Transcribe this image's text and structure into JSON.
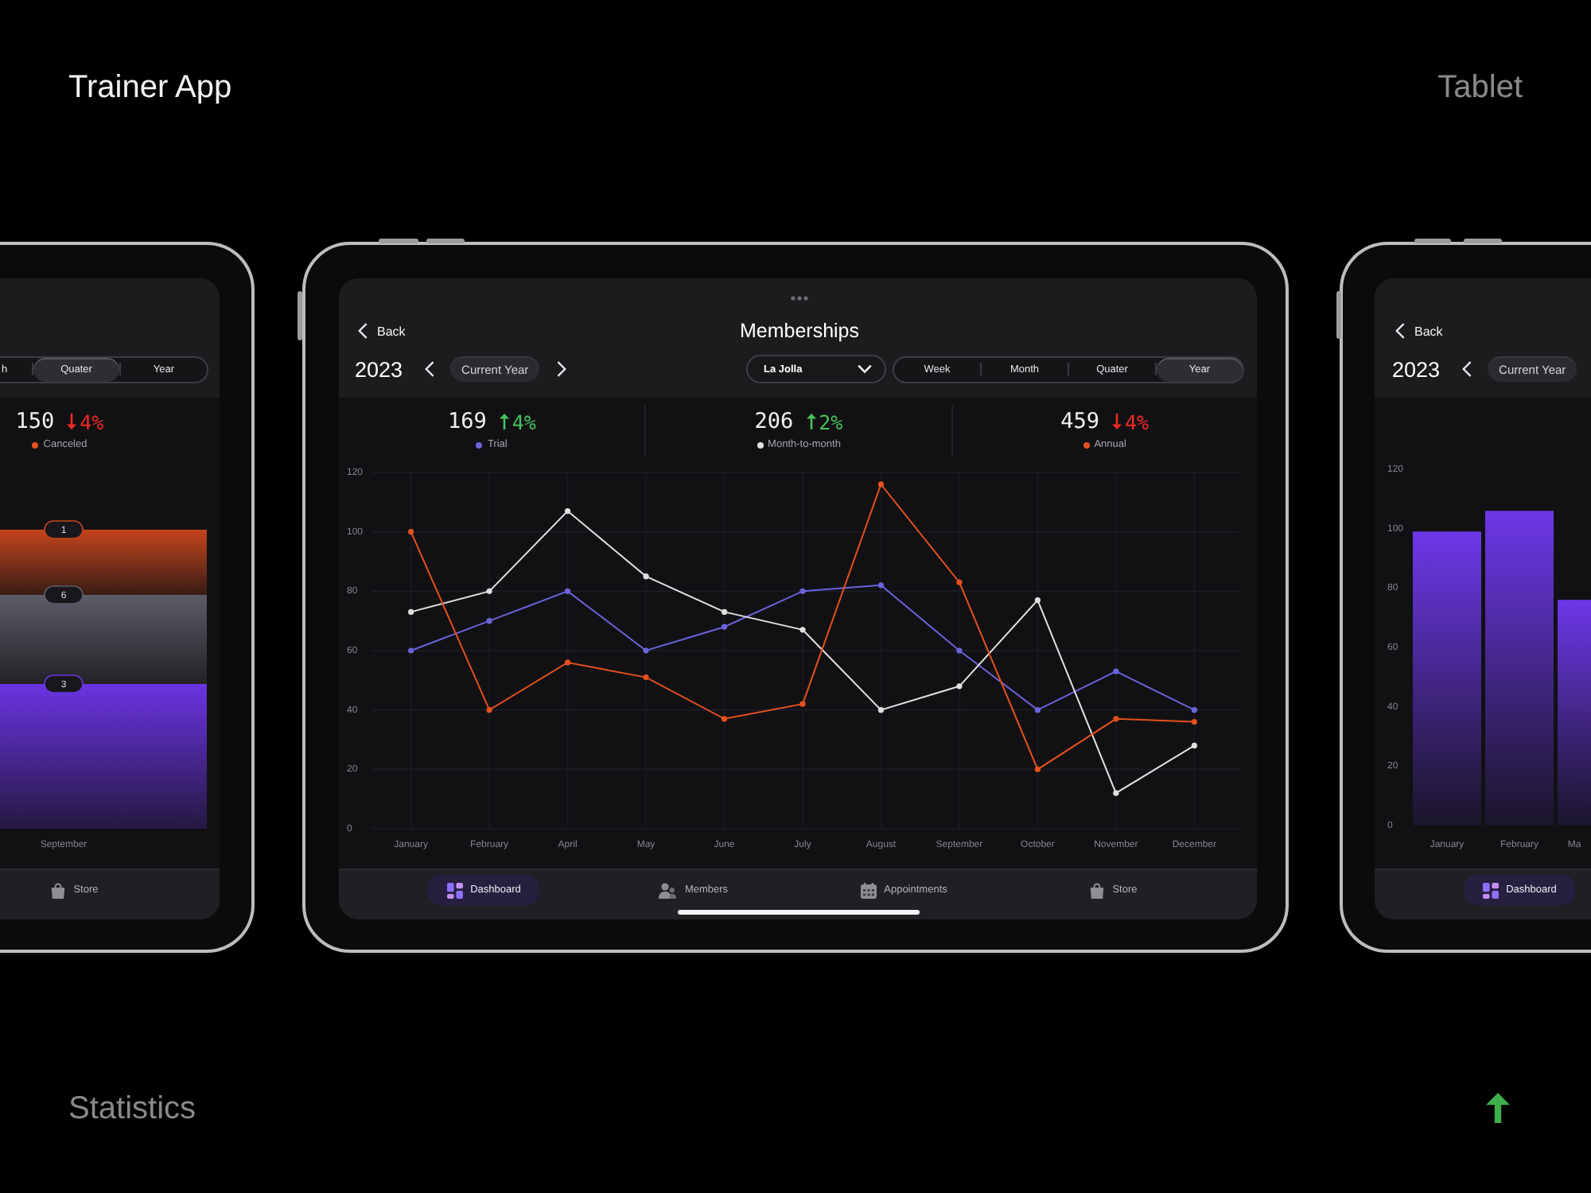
{
  "header": {
    "title": "Trainer App",
    "device": "Tablet"
  },
  "left_tablet": {
    "period_tabs": [
      {
        "label": "h",
        "selected": false
      },
      {
        "label": "Quater",
        "selected": true
      },
      {
        "label": "Year",
        "selected": false
      }
    ],
    "stats": [
      {
        "value": "150",
        "rising": false,
        "change": "4%",
        "label": "Canceled",
        "color": "#e5501e"
      }
    ],
    "stacked_bar": {
      "segments": [
        {
          "label": "1",
          "color": "#c4441b"
        },
        {
          "label": "6",
          "color": "#5c5c68"
        },
        {
          "label": "3",
          "color": "#6a34e2"
        }
      ],
      "category": "September"
    },
    "tab_bar": [
      {
        "kind": "store",
        "label": "Store",
        "selected": false
      }
    ]
  },
  "center_tablet": {
    "back": "Back",
    "title": "Memberships",
    "year": "2023",
    "period": "Current Year",
    "location": "La Jolla",
    "period_tabs": [
      {
        "label": "Week",
        "selected": false
      },
      {
        "label": "Month",
        "selected": false
      },
      {
        "label": "Quater",
        "selected": false
      },
      {
        "label": "Year",
        "selected": true
      }
    ],
    "stats": [
      {
        "value": "169",
        "rising": true,
        "change": "4%",
        "label": "Trial",
        "color": "#6b63dc"
      },
      {
        "value": "206",
        "rising": true,
        "change": "2%",
        "label": "Month-to-month",
        "color": "#e0e0e0"
      },
      {
        "value": "459",
        "rising": false,
        "change": "4%",
        "label": "Annual",
        "color": "#e5501e"
      }
    ],
    "chart_data": [
      {
        "type": "line",
        "categories": [
          "January",
          "February",
          "April",
          "May",
          "June",
          "July",
          "August",
          "September",
          "October",
          "November",
          "December"
        ],
        "ylim": [
          0,
          120
        ],
        "yticks": [
          0,
          20,
          40,
          60,
          80,
          100,
          120
        ],
        "grid": true,
        "marker": "circle",
        "series": [
          {
            "color": "#6b63dc",
            "values": [
              60,
              70,
              80,
              60,
              68,
              80,
              82,
              60,
              40,
              53,
              40
            ]
          },
          {
            "color": "#e0e0e0",
            "values": [
              73,
              80,
              107,
              85,
              73,
              67,
              40,
              48,
              77,
              12,
              28
            ]
          },
          {
            "color": "#e5501e",
            "values": [
              100,
              40,
              56,
              51,
              37,
              42,
              116,
              83,
              20,
              37,
              36
            ]
          }
        ]
      }
    ],
    "tab_bar": [
      {
        "kind": "dashboard",
        "label": "Dashboard",
        "selected": true
      },
      {
        "kind": "members",
        "label": "Members",
        "selected": false
      },
      {
        "kind": "appointments",
        "label": "Appointments",
        "selected": false
      },
      {
        "kind": "store",
        "label": "Store",
        "selected": false
      }
    ]
  },
  "right_tablet": {
    "back": "Back",
    "year": "2023",
    "period": "Current Year",
    "chart_data": [
      {
        "type": "bar",
        "categories": [
          "January",
          "February",
          "Ma"
        ],
        "values": [
          99,
          106,
          76
        ],
        "color": "#6c38e8",
        "ylim": [
          0,
          120
        ],
        "yticks": [
          0,
          20,
          40,
          60,
          80,
          100,
          120
        ]
      }
    ],
    "tab_bar": [
      {
        "kind": "dashboard",
        "label": "Dashboard",
        "selected": true
      }
    ]
  },
  "footer": {
    "section": "Statistics"
  }
}
